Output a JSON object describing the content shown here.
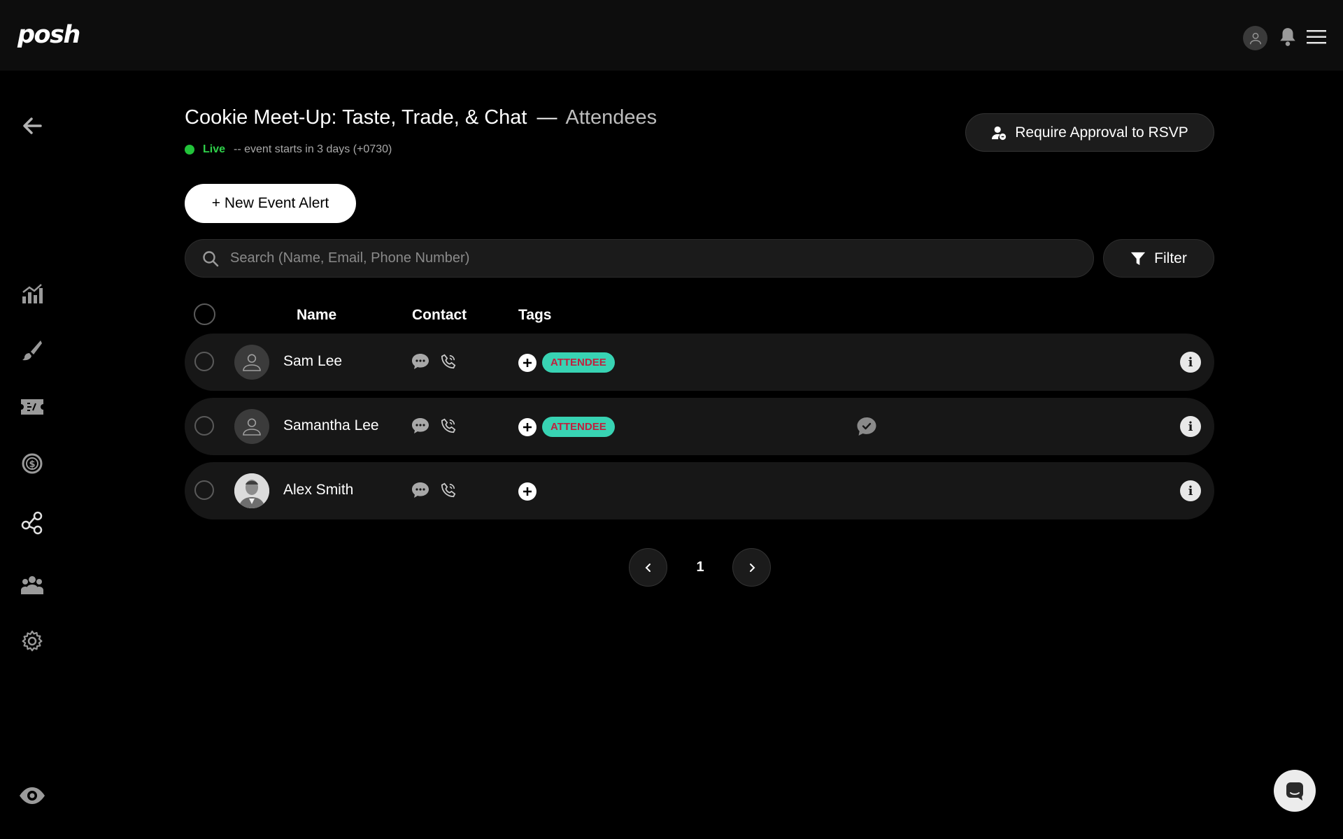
{
  "app": {
    "logo": "posh"
  },
  "header": {
    "event_title": "Cookie Meet-Up: Taste, Trade, & Chat",
    "separator": "—",
    "page_name": "Attendees",
    "status_label": "Live",
    "status_detail": "-- event starts in 3 days (+0730)",
    "status_color": "#22c33a"
  },
  "actions": {
    "require_approval_label": "Require Approval to RSVP",
    "new_event_alert_label": "+ New Event Alert",
    "filter_label": "Filter"
  },
  "search": {
    "placeholder": "Search (Name, Email, Phone Number)",
    "value": ""
  },
  "table": {
    "columns": {
      "name": "Name",
      "contact": "Contact",
      "tags": "Tags"
    },
    "rows": [
      {
        "name": "Sam Lee",
        "tag": "ATTENDEE",
        "avatar": "default-avatar",
        "message_status": ""
      },
      {
        "name": "Samantha Lee",
        "tag": "ATTENDEE",
        "avatar": "default-avatar",
        "message_status": "message-sent-check-icon"
      },
      {
        "name": "Alex Smith",
        "tag": "",
        "avatar": "photo-avatar",
        "message_status": ""
      }
    ]
  },
  "pagination": {
    "current_page": "1"
  },
  "sidebar": {
    "icons": [
      "back-arrow-icon",
      "analytics-icon",
      "brush-icon",
      "ticket-icon",
      "finance-icon",
      "network-icon",
      "team-icon",
      "settings-icon",
      "preview-eye-icon"
    ]
  },
  "colors": {
    "tag_bg": "#38d3b3",
    "tag_text": "#c0203e",
    "background": "#000000",
    "row_bg": "#171717"
  }
}
